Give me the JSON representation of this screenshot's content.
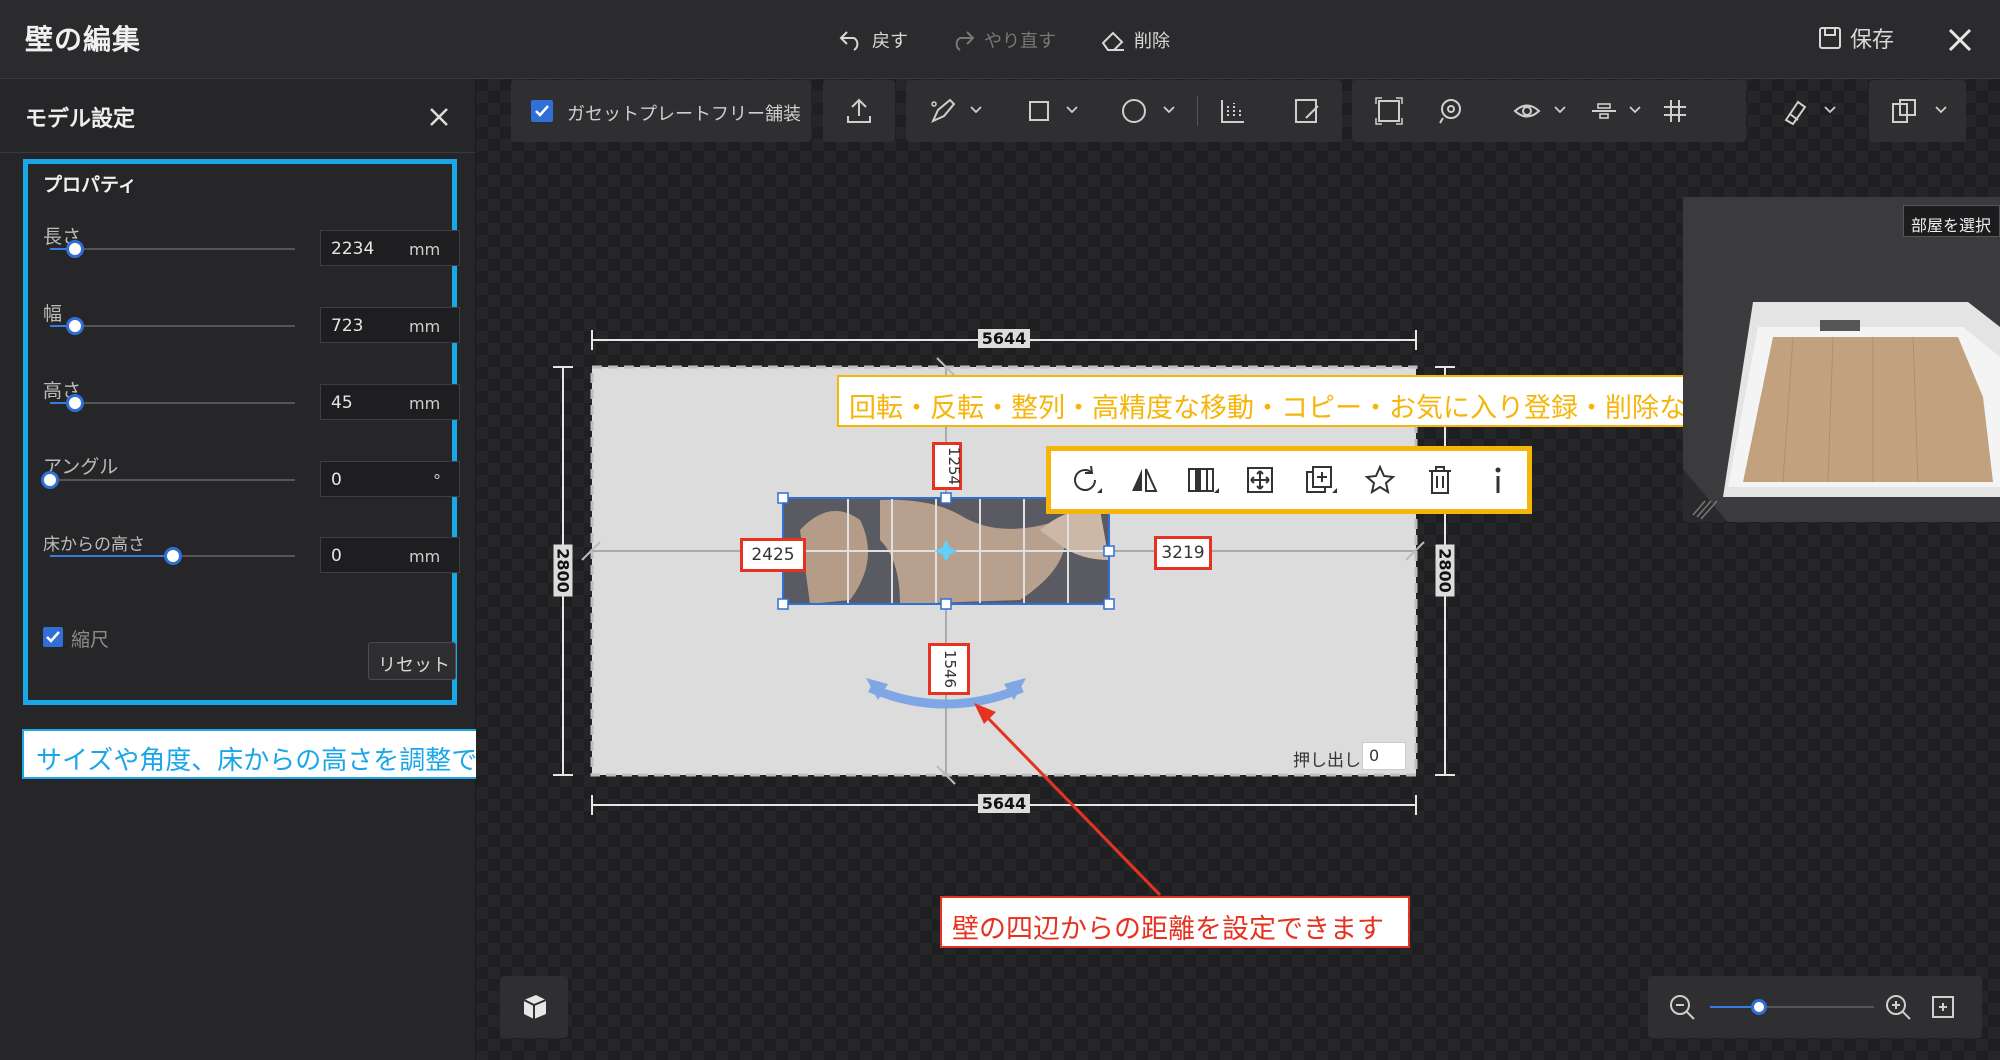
{
  "app": {
    "title": "壁の編集"
  },
  "toolbar_top": {
    "undo_label": "戻す",
    "redo_label": "やり直す",
    "delete_label": "削除",
    "save_label": "保存"
  },
  "left_panel": {
    "title": "モデル設定",
    "section_title": "プロパティ",
    "properties": [
      {
        "label": "長さ",
        "value": "2234",
        "unit": "mm",
        "slider_fraction": 0.1
      },
      {
        "label": "幅",
        "value": "723",
        "unit": "mm",
        "slider_fraction": 0.1
      },
      {
        "label": "高さ",
        "value": "45",
        "unit": "mm",
        "slider_fraction": 0.1
      },
      {
        "label": "アングル",
        "value": "0",
        "unit": "°",
        "slider_fraction": 0.0
      },
      {
        "label": "床からの高さ",
        "value": "0",
        "unit": "mm",
        "slider_fraction": 0.5
      }
    ],
    "scale_label": "縮尺",
    "scale_checked": true,
    "reset_label": "リセット"
  },
  "canvas_toolbar": {
    "gusset_label": "ガセットプレートフリー舗装",
    "gusset_checked": true
  },
  "drawing": {
    "width_top": "5644",
    "width_bottom": "5644",
    "height_left": "2800",
    "height_right": "2800",
    "dist_top": "1254",
    "dist_left": "2425",
    "dist_right": "3219",
    "dist_bottom": "1546",
    "extrude_label": "押し出し",
    "extrude_value": "0"
  },
  "callouts": {
    "blue": "サイズや角度、床からの高さを調整できます",
    "yellow": "回転・反転・整列・高精度な移動・コピー・お気に入り登録・削除などの操作が行えます",
    "red": "壁の四辺からの距離を設定できます"
  },
  "preview": {
    "room_select_label": "部屋を選択"
  },
  "zoom": {
    "level_fraction": 0.3
  },
  "colors": {
    "accent": "#2f6fd6",
    "callout_blue": "#1aa7e8",
    "callout_yellow": "#f5b50a",
    "callout_red": "#e53321"
  }
}
